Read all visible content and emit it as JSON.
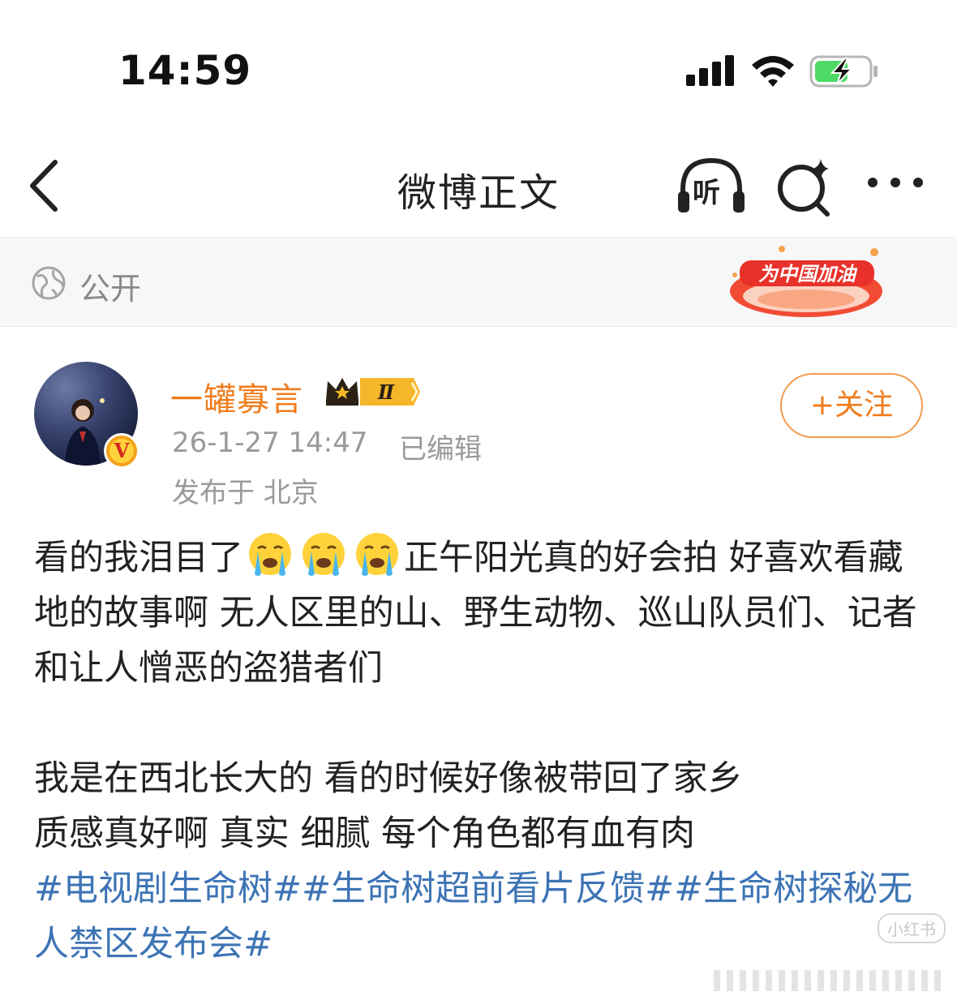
{
  "status_bar": {
    "time": "14:59",
    "icons": [
      "signal-icon",
      "wifi-icon",
      "battery-charging-icon"
    ],
    "battery_color": "#4cd964"
  },
  "nav": {
    "title": "微博正文",
    "listen_label": "听",
    "icons": [
      "back-icon",
      "listen-headphone-icon",
      "ai-search-icon",
      "more-icon"
    ]
  },
  "visibility": {
    "label": "公开",
    "banner_text": "为中国加油"
  },
  "post": {
    "author": "一罐寡言",
    "level": "Ⅱ",
    "verified_mark": "V",
    "time": "26-1-27 14:47",
    "edited": "已编辑",
    "location": "发布于 北京",
    "follow_label": "+关注",
    "text_part1_a": "看的我泪目了",
    "text_part1_b": "正午阳光真的好会拍 好喜欢看藏地的故事啊 无人区里的山、野生动物、巡山队员们、记者和让人憎恶的盗猎者们",
    "text_para2": "我是在西北长大的 看的时候好像被带回了家乡",
    "text_para3": "质感真好啊 真实 细腻 每个角色都有血有肉",
    "hashtags": [
      "#电视剧生命树#",
      "#生命树超前看片反馈#",
      "#生命树探秘无人禁区发布会#"
    ],
    "emojis": [
      "crying-emoji",
      "crying-emoji",
      "crying-emoji"
    ]
  },
  "watermark": "小红书",
  "colors": {
    "accent": "#f07c1c",
    "link": "#3d74b5",
    "muted": "#9a9a9a"
  }
}
